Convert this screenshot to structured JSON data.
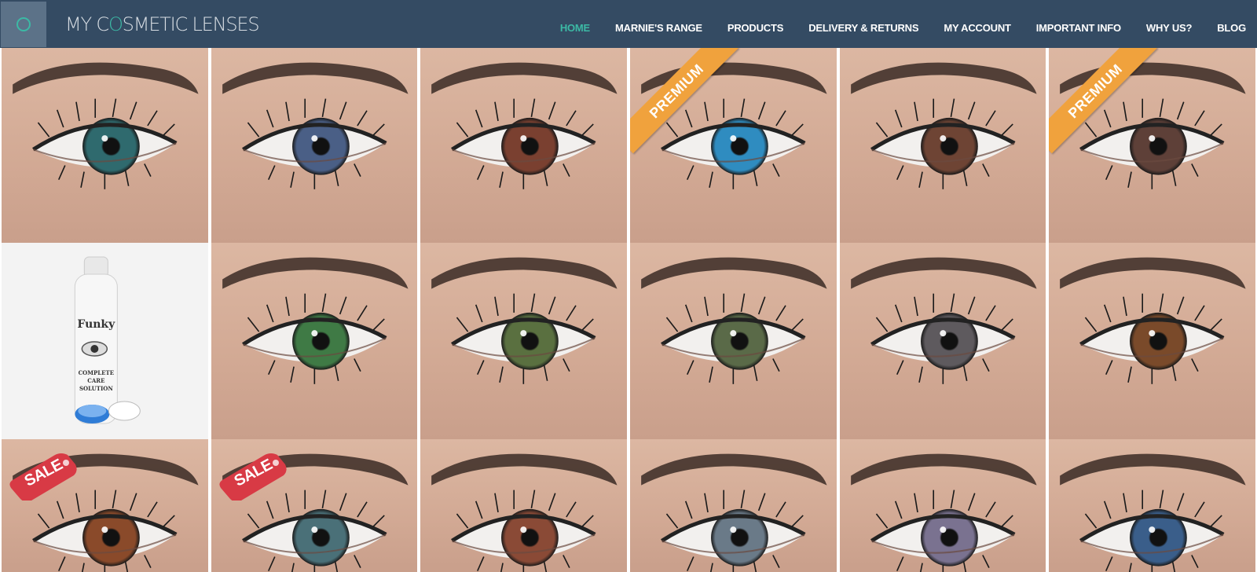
{
  "header": {
    "brand_pre": "MY C",
    "brand_o": "O",
    "brand_post": "SMETIC LENSES"
  },
  "nav": {
    "items": [
      {
        "label": "HOME",
        "active": true
      },
      {
        "label": "MARNIE'S RANGE"
      },
      {
        "label": "PRODUCTS"
      },
      {
        "label": "DELIVERY & RETURNS"
      },
      {
        "label": "MY ACCOUNT"
      },
      {
        "label": "IMPORTANT INFO"
      },
      {
        "label": "WHY US?"
      },
      {
        "label": "BLOG"
      }
    ]
  },
  "tiles": [
    {
      "iris": "#2f6a6e",
      "badge": ""
    },
    {
      "iris": "#4a5f86",
      "badge": ""
    },
    {
      "iris": "#7a4030",
      "badge": ""
    },
    {
      "iris": "#2f8cc0",
      "badge": "PREMIUM"
    },
    {
      "iris": "#6e4434",
      "badge": ""
    },
    {
      "iris": "#5e4038",
      "badge": "PREMIUM"
    },
    {
      "iris": "",
      "badge": "",
      "product": "care-solution"
    },
    {
      "iris": "#3f7a45",
      "badge": ""
    },
    {
      "iris": "#5a7040",
      "badge": ""
    },
    {
      "iris": "#5a6a48",
      "badge": ""
    },
    {
      "iris": "#5e5a5e",
      "badge": ""
    },
    {
      "iris": "#7a4a2a",
      "badge": ""
    },
    {
      "iris": "#8a4a2a",
      "badge": "SALE"
    },
    {
      "iris": "#4a7078",
      "badge": "SALE"
    },
    {
      "iris": "#8a4a36",
      "badge": ""
    },
    {
      "iris": "#6a7a88",
      "badge": ""
    },
    {
      "iris": "#7a7290",
      "badge": ""
    },
    {
      "iris": "#3a5e8a",
      "badge": ""
    }
  ],
  "product_label": {
    "brand": "Funky",
    "line1": "COMPLETE",
    "line2": "CARE",
    "line3": "SOLUTION"
  }
}
